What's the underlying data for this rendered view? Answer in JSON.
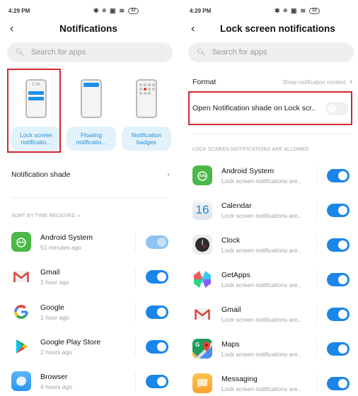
{
  "status_bar": {
    "time": "4:29 PM",
    "battery": "32",
    "icons": [
      "bluetooth-icon",
      "alarm-off-icon",
      "nfc-icon",
      "wifi-icon",
      "battery-icon"
    ]
  },
  "left": {
    "title": "Notifications",
    "search_placeholder": "Search for apps",
    "modes": [
      {
        "label": "Lock screen notificatio...",
        "clock": "2:36",
        "selected": true
      },
      {
        "label": "Floating notificatio...",
        "selected": false
      },
      {
        "label": "Notification badges",
        "selected": false
      }
    ],
    "notification_shade": "Notification shade",
    "sort_label": "SORT BY TIME RECEIVED",
    "apps": [
      {
        "name": "Android System",
        "sub": "51 minutes ago",
        "enabled": true,
        "faded": true
      },
      {
        "name": "Gmail",
        "sub": "1 hour ago",
        "enabled": true
      },
      {
        "name": "Google",
        "sub": "1 hour ago",
        "enabled": true
      },
      {
        "name": "Google Play Store",
        "sub": "2 hours ago",
        "enabled": true
      },
      {
        "name": "Browser",
        "sub": "4 hours ago",
        "enabled": true
      }
    ]
  },
  "right": {
    "title": "Lock screen notifications",
    "search_placeholder": "Search for apps",
    "format_label": "Format",
    "format_value": "Show notification content",
    "open_shade_label": "Open Notification shade on Lock scr..",
    "open_shade_enabled": false,
    "section_label": "LOCK SCREEN NOTIFICATIONS ARE ALLOWED",
    "apps": [
      {
        "name": "Android System",
        "sub": "Lock screen notifications are..",
        "enabled": true
      },
      {
        "name": "Calendar",
        "sub": "Lock screen notifications are..",
        "enabled": true,
        "icon_text": "16"
      },
      {
        "name": "Clock",
        "sub": "Lock screen notifications are..",
        "enabled": true
      },
      {
        "name": "GetApps",
        "sub": "Lock screen notifications are..",
        "enabled": true
      },
      {
        "name": "Gmail",
        "sub": "Lock screen notifications are..",
        "enabled": true
      },
      {
        "name": "Maps",
        "sub": "Lock screen notifications are..",
        "enabled": true
      },
      {
        "name": "Messaging",
        "sub": "Lock screen notifications are..",
        "enabled": true
      }
    ]
  },
  "colors": {
    "accent": "#1a86e8",
    "highlight": "#d0282e",
    "mode_label_bg": "#e2f2fb"
  }
}
